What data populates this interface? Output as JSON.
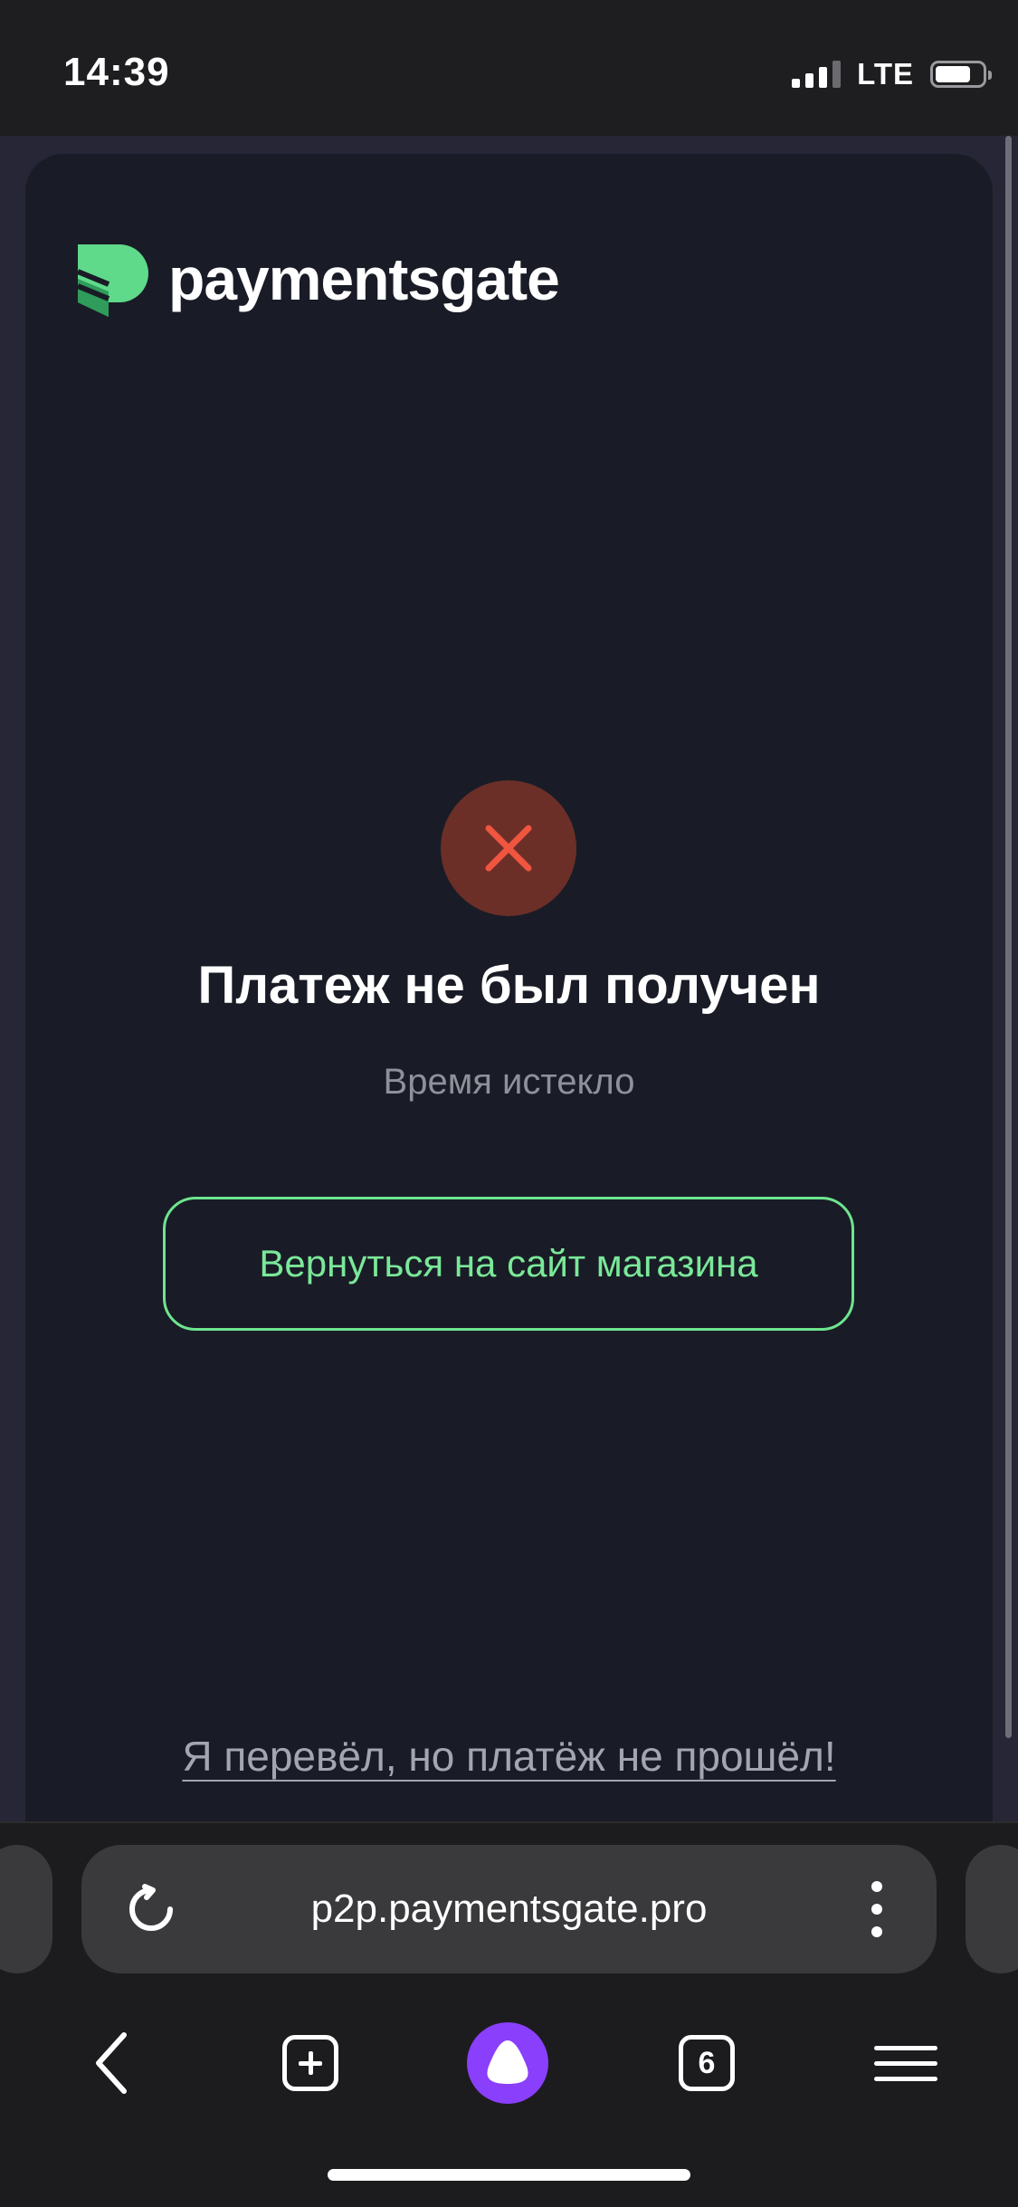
{
  "status_bar": {
    "time": "14:39",
    "network": "LTE",
    "signal_icon": "signal-bars-icon",
    "battery_icon": "battery-icon"
  },
  "page": {
    "logo": {
      "text": "paymentsgate",
      "icon": "paymentsgate-logo-icon",
      "color": "#5fd98a"
    },
    "status_icon": "error-x-icon",
    "title": "Платеж не был получен",
    "subtitle": "Время истекло",
    "return_button_label": "Вернуться на сайт магазина",
    "issue_link_label": "Я перевёл, но платёж не прошёл!",
    "colors": {
      "accent": "#6ee58e",
      "error_icon": "#f0553f",
      "error_circle": "#6b2f28",
      "card_background": "#191c26"
    }
  },
  "browser": {
    "url": "p2p.paymentsgate.pro",
    "reload_icon": "reload-icon",
    "more_icon": "more-vertical-icon",
    "toolbar": {
      "back_icon": "back-arrow-icon",
      "new_tab_icon": "new-tab-icon",
      "assistant_icon": "alice-assistant-icon",
      "tabs_count": "6",
      "menu_icon": "hamburger-menu-icon"
    },
    "assistant_color": "#8a3ffc"
  }
}
